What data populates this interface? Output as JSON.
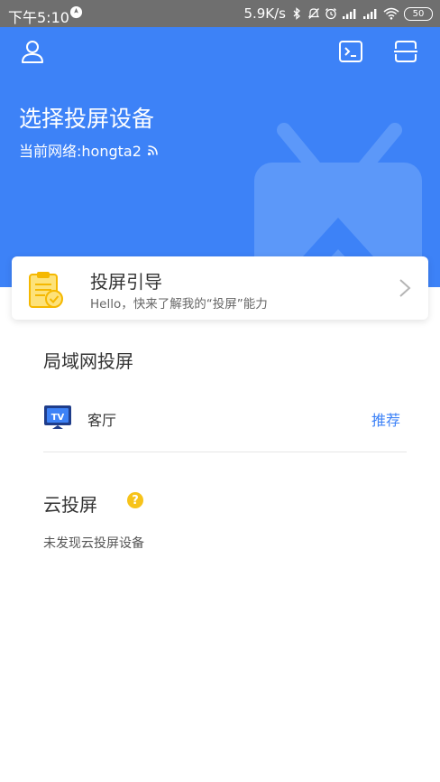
{
  "status_bar": {
    "time": "下午5:10",
    "network_speed": "5.9K/s",
    "battery_level": "50",
    "icons": [
      "location-icon",
      "bluetooth-icon",
      "mute-icon",
      "alarm-icon",
      "signal-icon",
      "signal-icon",
      "wifi-icon",
      "battery-icon"
    ]
  },
  "header": {
    "background_color": "#3d82f7",
    "title": "选择投屏设备",
    "network_label": "当前网络:hongta2",
    "icons": [
      "user-icon",
      "terminal-icon",
      "scan-icon",
      "wifi-signal-icon",
      "tv-watermark-icon"
    ]
  },
  "guide": {
    "title": "投屏引导",
    "description": "Hello，快来了解我的“投屏”能力",
    "icons": [
      "clipboard-check-icon",
      "chevron-right-icon"
    ]
  },
  "lan": {
    "title": "局域网投屏",
    "devices": [
      {
        "name": "客厅",
        "badge": "推荐",
        "icon": "tv-icon"
      }
    ]
  },
  "cloud": {
    "title": "云投屏",
    "help_symbol": "?",
    "empty_text": "未发现云投屏设备"
  },
  "accent_color": "#3d82f7",
  "help_color": "#f7c31a"
}
